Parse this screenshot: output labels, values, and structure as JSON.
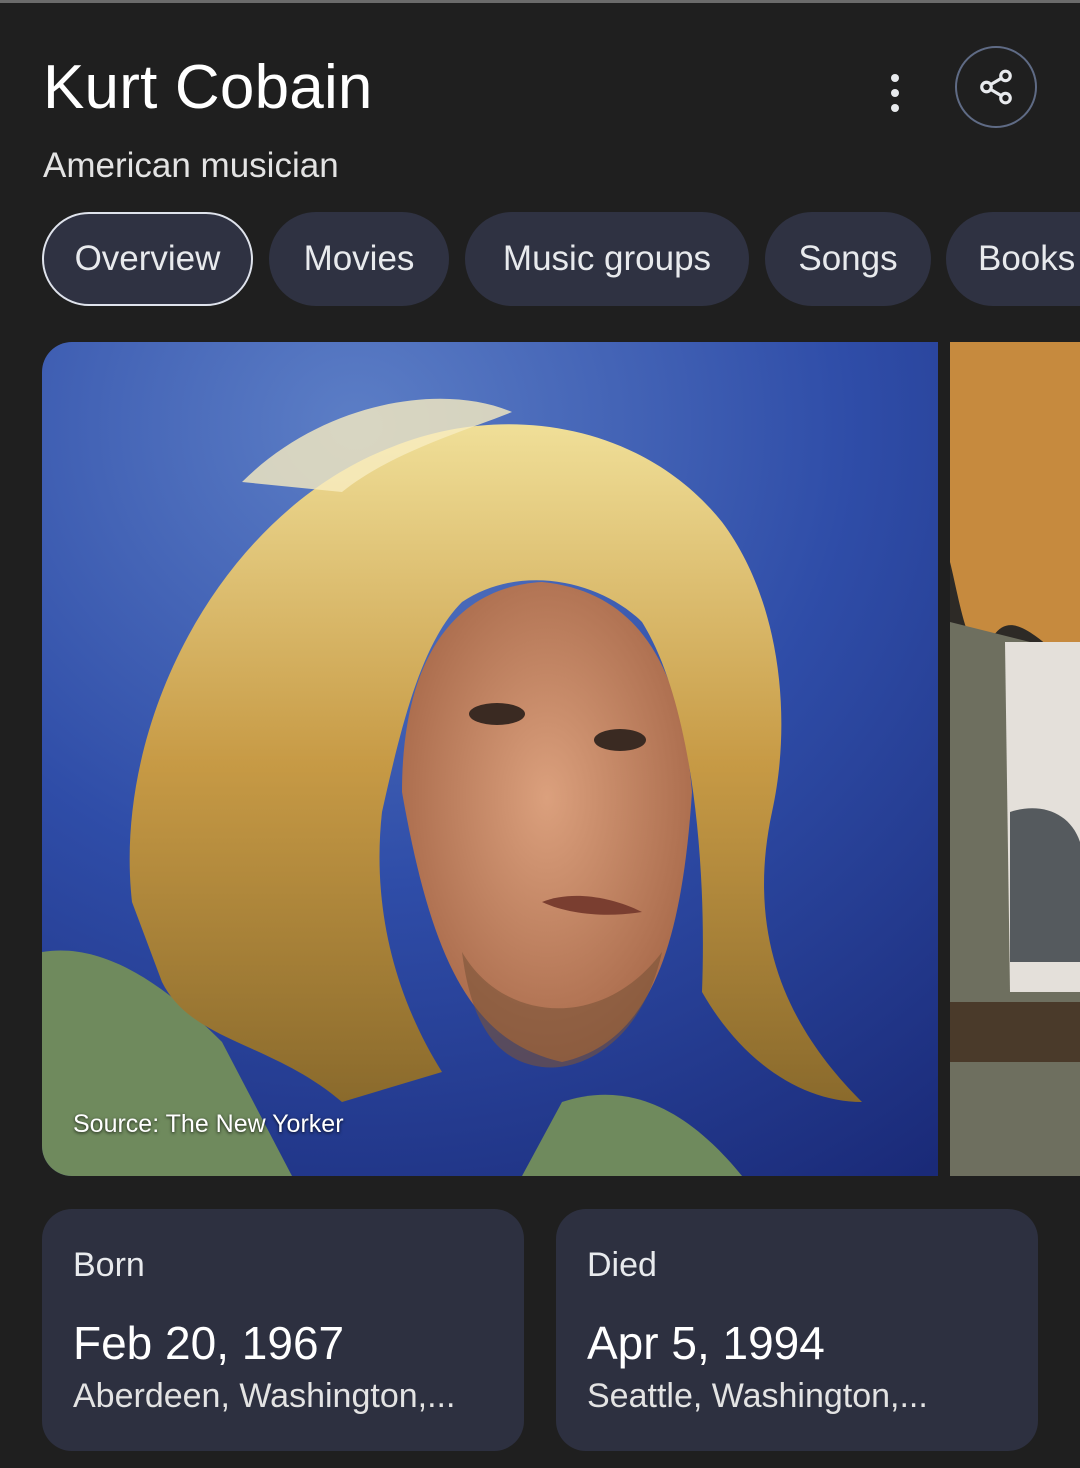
{
  "entity": {
    "name": "Kurt Cobain",
    "description": "American musician"
  },
  "header": {
    "more_icon": "more-vert-icon",
    "share_icon": "share-icon"
  },
  "tabs": [
    {
      "label": "Overview",
      "active": true
    },
    {
      "label": "Movies",
      "active": false
    },
    {
      "label": "Music groups",
      "active": false
    },
    {
      "label": "Songs",
      "active": false
    },
    {
      "label": "Books",
      "active": false
    }
  ],
  "images": {
    "primary_source": "Source: The New Yorker"
  },
  "facts": {
    "born": {
      "label": "Born",
      "date": "Feb 20, 1967",
      "place": "Aberdeen, Washington,..."
    },
    "died": {
      "label": "Died",
      "date": "Apr 5, 1994",
      "place": "Seattle, Washington,..."
    }
  },
  "colors": {
    "background": "#1f1f1f",
    "chip": "#2f3242",
    "card": "#2d3040",
    "active_border": "#dfe3ec"
  }
}
